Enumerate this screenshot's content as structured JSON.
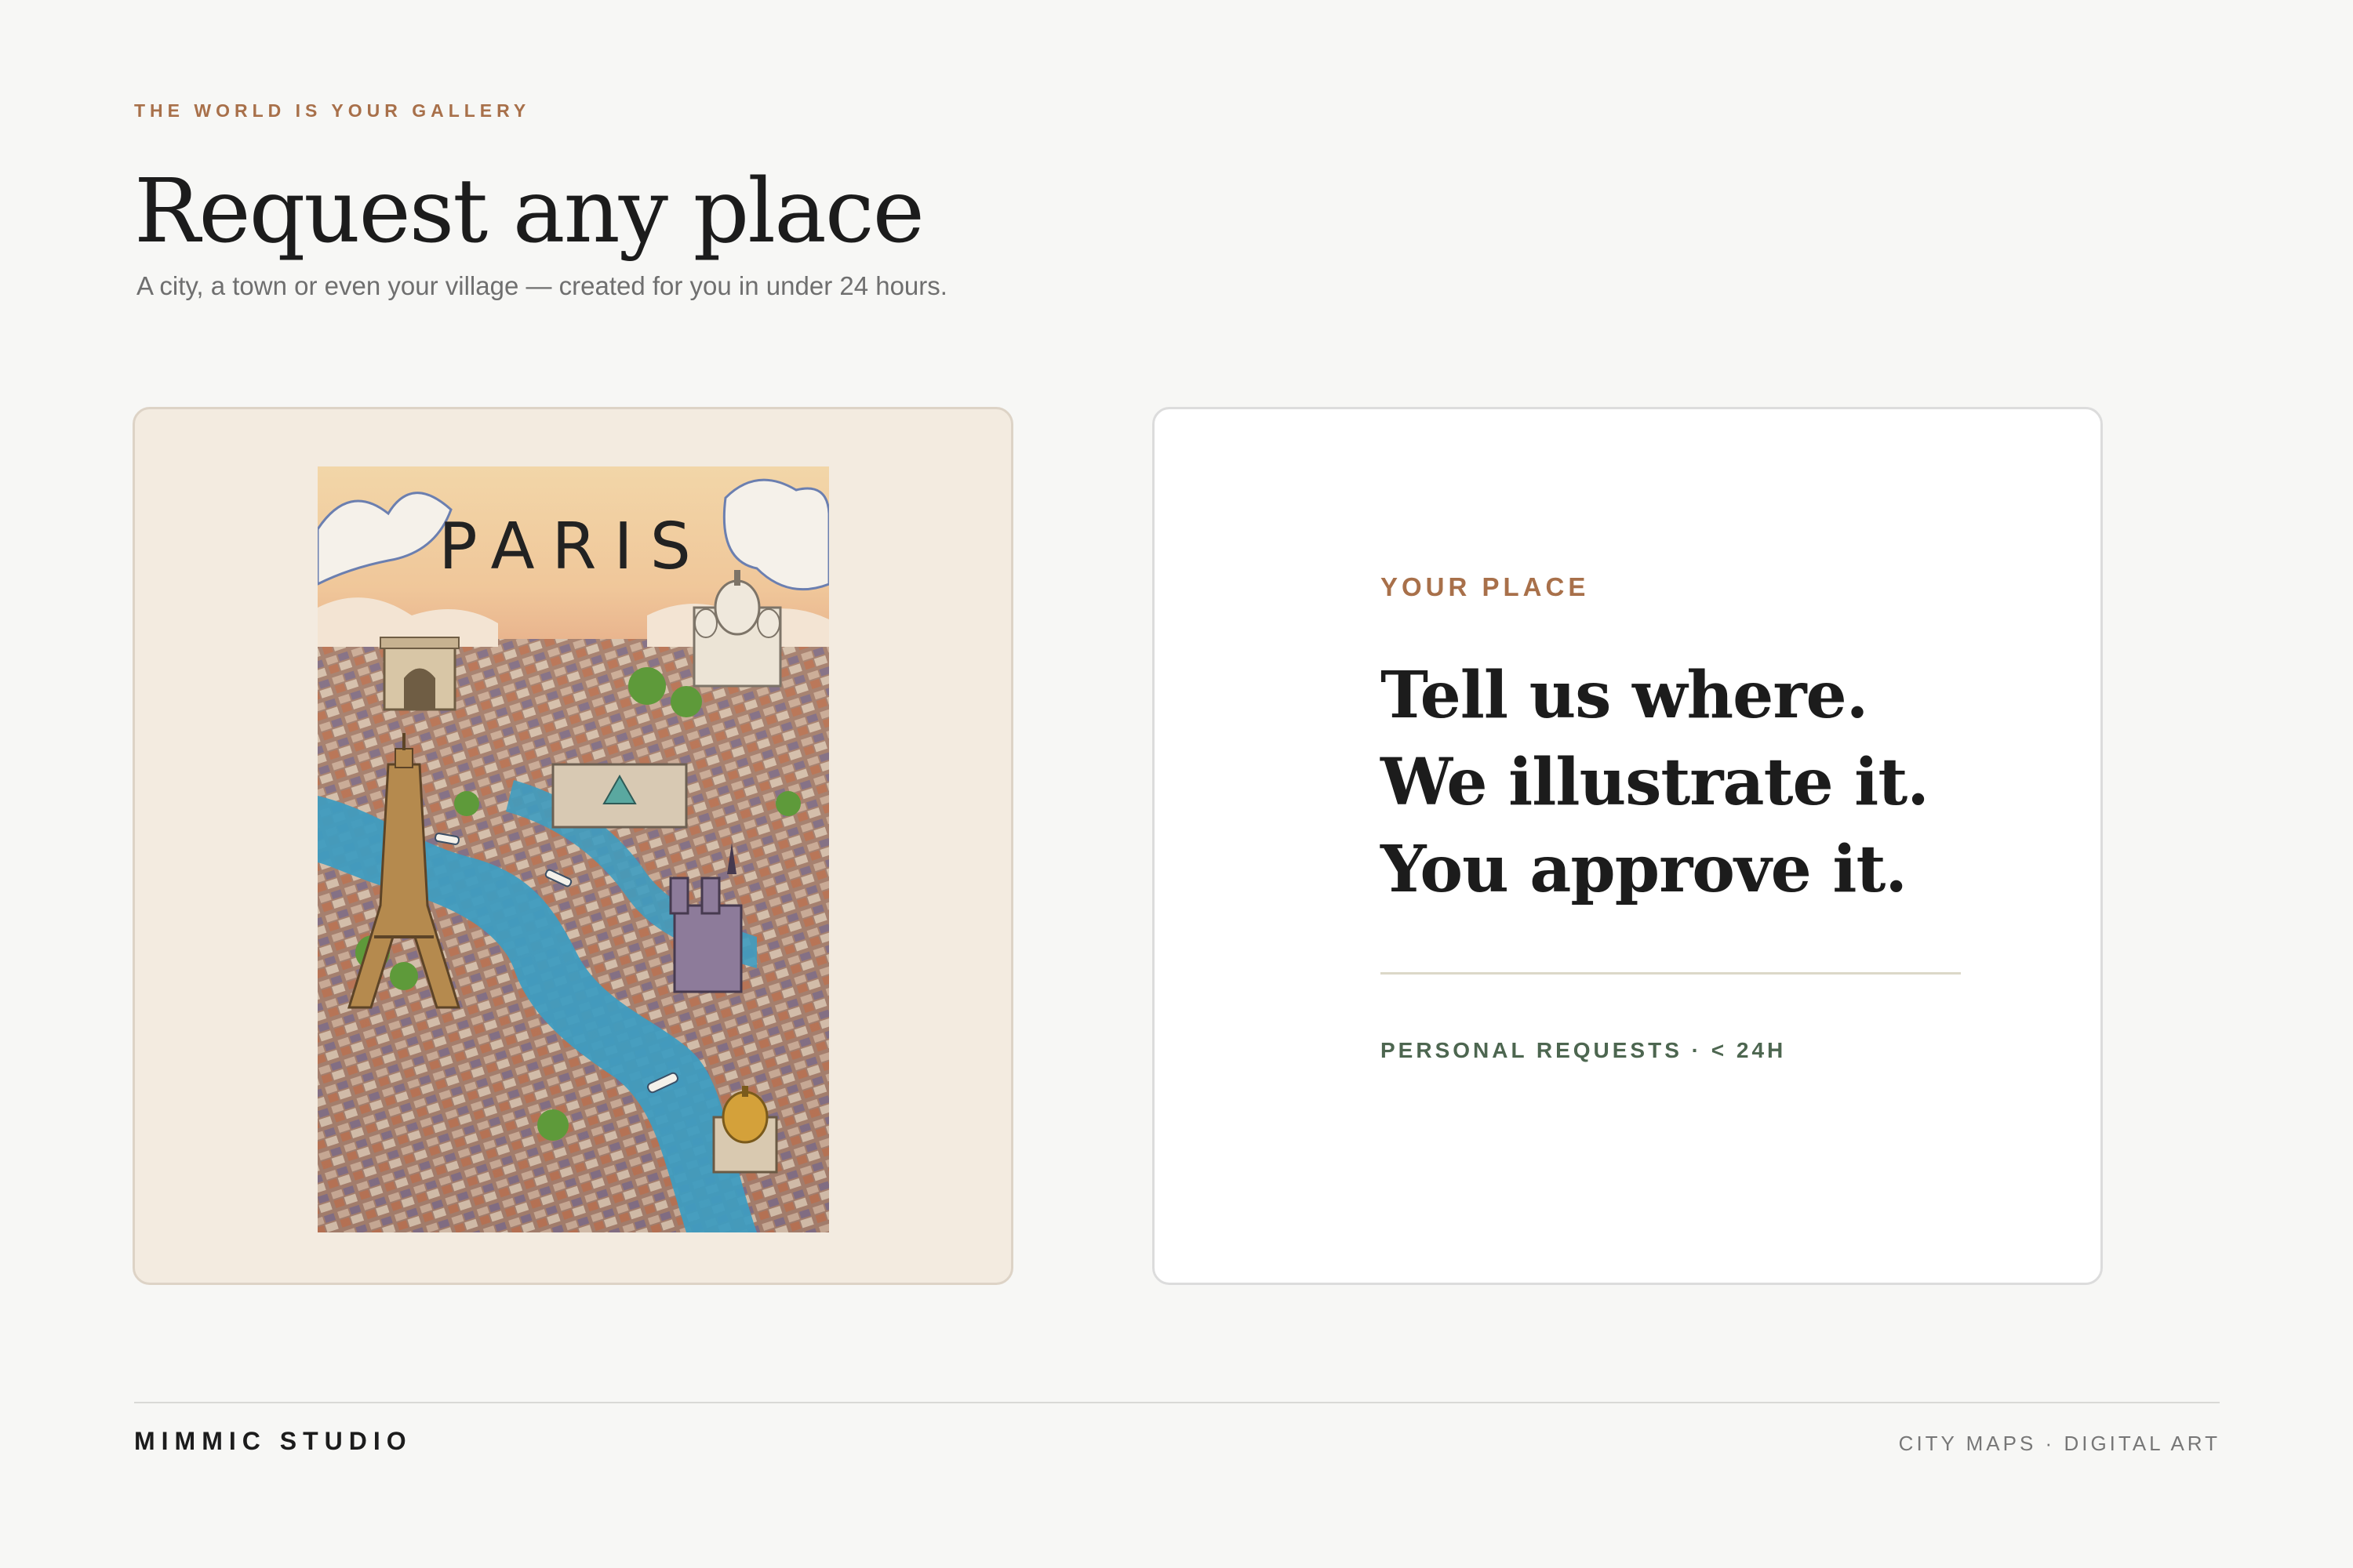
{
  "header": {
    "eyebrow": "THE WORLD IS YOUR GALLERY",
    "title": "Request any place",
    "subtitle": "A city, a town or even your village — created for you in under 24 hours."
  },
  "poster": {
    "city": "PARIS",
    "landmark_icons": [
      "eiffel-tower-icon",
      "arc-de-triomphe-icon",
      "sacre-coeur-icon",
      "notre-dame-icon",
      "invalides-dome-icon"
    ]
  },
  "card": {
    "label": "YOUR PLACE",
    "headline_lines": [
      "Tell us where.",
      "We illustrate it.",
      "You approve it."
    ],
    "meta": "PERSONAL REQUESTS · < 24H"
  },
  "footer": {
    "brand": "MIMMIC STUDIO",
    "tagline": "CITY MAPS · DIGITAL ART"
  },
  "colors": {
    "page_bg": "#f7f7f5",
    "accent": "#a8704a",
    "meta_green": "#4d6650",
    "image_card_bg": "#f3ebe0",
    "river": "#3f9cc0"
  }
}
